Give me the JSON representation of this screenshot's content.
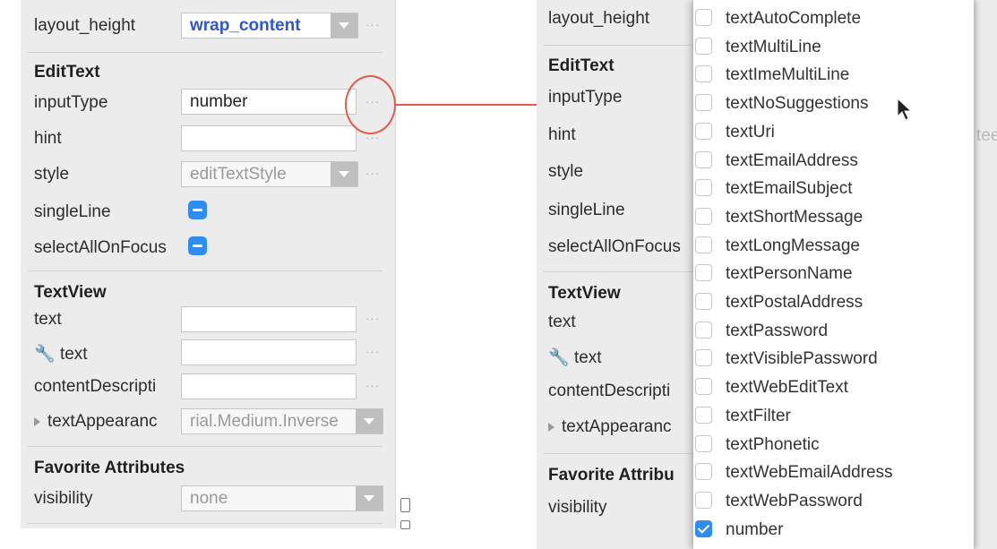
{
  "left": {
    "layout_height": {
      "label": "layout_height",
      "value": "wrap_content"
    },
    "edittext": {
      "title": "EditText",
      "inputType": {
        "label": "inputType",
        "value": "number"
      },
      "hint": {
        "label": "hint",
        "value": ""
      },
      "style": {
        "label": "style",
        "value": "editTextStyle"
      },
      "singleLine": {
        "label": "singleLine"
      },
      "selectAllOnFocus": {
        "label": "selectAllOnFocus"
      }
    },
    "textview": {
      "title": "TextView",
      "text": {
        "label": "text",
        "value": ""
      },
      "tools_text": {
        "label": "text",
        "value": ""
      },
      "contentDescription": {
        "label": "contentDescripti",
        "value": ""
      },
      "textAppearance": {
        "label": "textAppearanc",
        "value": "rial.Medium.Inverse"
      }
    },
    "favorites": {
      "title": "Favorite Attributes",
      "visibility": {
        "label": "visibility",
        "value": "none"
      }
    },
    "dots": "···"
  },
  "right": {
    "labels": {
      "layout_height": "layout_height",
      "edittext": "EditText",
      "inputType": "inputType",
      "hint": "hint",
      "style": "style",
      "singleLine": "singleLine",
      "selectAllOnFocus": "selectAllOnFocus",
      "textview": "TextView",
      "text": "text",
      "tools_text": "text",
      "contentDescription": "contentDescripti",
      "textAppearance": "textAppearanc",
      "favorites": "Favorite Attribu",
      "visibility": "visibility"
    },
    "teaser": "tee",
    "options": [
      {
        "label": "textAutoComplete",
        "checked": false
      },
      {
        "label": "textMultiLine",
        "checked": false
      },
      {
        "label": "textImeMultiLine",
        "checked": false
      },
      {
        "label": "textNoSuggestions",
        "checked": false
      },
      {
        "label": "textUri",
        "checked": false
      },
      {
        "label": "textEmailAddress",
        "checked": false
      },
      {
        "label": "textEmailSubject",
        "checked": false
      },
      {
        "label": "textShortMessage",
        "checked": false
      },
      {
        "label": "textLongMessage",
        "checked": false
      },
      {
        "label": "textPersonName",
        "checked": false
      },
      {
        "label": "textPostalAddress",
        "checked": false
      },
      {
        "label": "textPassword",
        "checked": false
      },
      {
        "label": "textVisiblePassword",
        "checked": false
      },
      {
        "label": "textWebEditText",
        "checked": false
      },
      {
        "label": "textFilter",
        "checked": false
      },
      {
        "label": "textPhonetic",
        "checked": false
      },
      {
        "label": "textWebEmailAddress",
        "checked": false
      },
      {
        "label": "textWebPassword",
        "checked": false
      },
      {
        "label": "number",
        "checked": true
      }
    ]
  },
  "colors": {
    "accent": "#2f8cf1",
    "callout": "#e25a4b",
    "panel": "#ececec"
  }
}
